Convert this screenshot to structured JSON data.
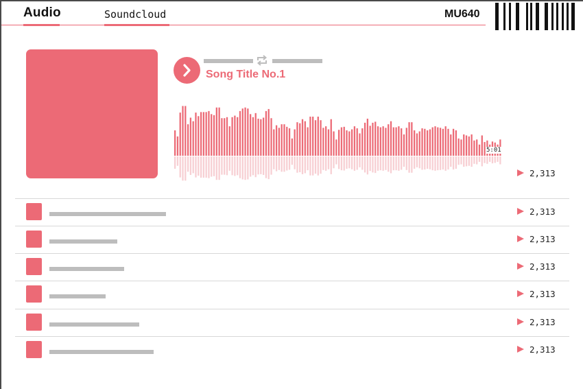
{
  "header": {
    "tabs": [
      {
        "label": "Audio",
        "active": true
      },
      {
        "label": "Soundcloud",
        "active": true
      }
    ],
    "model": "MU640",
    "barcode_icon": "barcode-icon"
  },
  "player": {
    "song_title": "Song Title No.1",
    "duration": "5:01",
    "plays": "2,313",
    "play_icon": "play-icon",
    "repeat_icon": "repeat-icon",
    "waveform_levels": [
      0.5,
      0.38,
      0.85,
      0.98,
      0.98,
      0.62,
      0.75,
      0.68,
      0.85,
      0.78,
      0.86,
      0.86,
      0.86,
      0.88,
      0.82,
      0.8,
      0.95,
      0.95,
      0.74,
      0.74,
      0.76,
      0.58,
      0.76,
      0.79,
      0.76,
      0.88,
      0.93,
      0.95,
      0.93,
      0.82,
      0.76,
      0.84,
      0.73,
      0.72,
      0.75,
      0.88,
      0.92,
      0.74,
      0.52,
      0.6,
      0.55,
      0.62,
      0.62,
      0.57,
      0.54,
      0.34,
      0.52,
      0.66,
      0.64,
      0.72,
      0.68,
      0.56,
      0.77,
      0.77,
      0.7,
      0.77,
      0.7,
      0.55,
      0.58,
      0.52,
      0.72,
      0.48,
      0.32,
      0.51,
      0.56,
      0.57,
      0.5,
      0.48,
      0.52,
      0.58,
      0.54,
      0.44,
      0.54,
      0.65,
      0.73,
      0.59,
      0.65,
      0.67,
      0.58,
      0.56,
      0.58,
      0.55,
      0.62,
      0.68,
      0.56,
      0.56,
      0.58,
      0.54,
      0.42,
      0.55,
      0.66,
      0.66,
      0.5,
      0.44,
      0.48,
      0.54,
      0.53,
      0.5,
      0.52,
      0.56,
      0.58,
      0.56,
      0.55,
      0.53,
      0.58,
      0.53,
      0.42,
      0.53,
      0.5,
      0.34,
      0.32,
      0.42,
      0.4,
      0.38,
      0.42,
      0.3,
      0.32,
      0.22,
      0.4,
      0.27,
      0.3,
      0.22,
      0.28,
      0.26,
      0.22,
      0.32
    ],
    "waveform_played_fraction": 1.0
  },
  "tracks": [
    {
      "plays": "2,313",
      "title_length": 170
    },
    {
      "plays": "2,313",
      "title_length": 99
    },
    {
      "plays": "2,313",
      "title_length": 109
    },
    {
      "plays": "2,313",
      "title_length": 82
    },
    {
      "plays": "2,313",
      "title_length": 131
    },
    {
      "plays": "2,313",
      "title_length": 152
    }
  ],
  "colors": {
    "accent": "#ec6a76",
    "accent_light": "#f7cfd3",
    "placeholder": "#bdbdbd",
    "divider": "#d8d8d8"
  }
}
